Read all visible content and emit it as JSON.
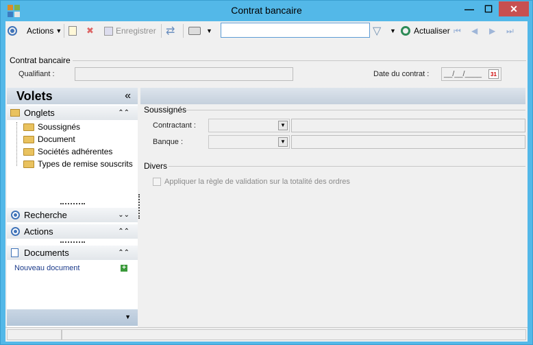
{
  "window": {
    "title": "Contrat bancaire",
    "min": "—",
    "max": "☐",
    "close": "✕"
  },
  "toolbar": {
    "actions_label": "Actions",
    "save_label": "Enregistrer",
    "refresh_label": "Actualiser",
    "search_value": ""
  },
  "header": {
    "group_title": "Contrat bancaire",
    "qualifiant_label": "Qualifiant :",
    "qualifiant_value": "",
    "date_label": "Date du contrat :",
    "date_value": "__/__/____",
    "calendar_day": "31"
  },
  "left_panel": {
    "title": "Volets",
    "collapse_glyph": "«",
    "onglets": {
      "title": "Onglets",
      "items": [
        "Soussignés",
        "Document",
        "Sociétés adhérentes",
        "Types de remise souscrits"
      ]
    },
    "recherche": {
      "title": "Recherche"
    },
    "actions": {
      "title": "Actions"
    },
    "documents": {
      "title": "Documents",
      "new_doc": "Nouveau document"
    }
  },
  "form": {
    "soussignes_title": "Soussignés",
    "contractant_label": "Contractant :",
    "banque_label": "Banque :",
    "divers_title": "Divers",
    "checkbox_label": "Appliquer la règle de validation sur la totalité des ordres",
    "checkbox_checked": false
  },
  "colors": {
    "titlebar": "#53b8e8",
    "accent": "#3f73b8",
    "close": "#c75050"
  }
}
